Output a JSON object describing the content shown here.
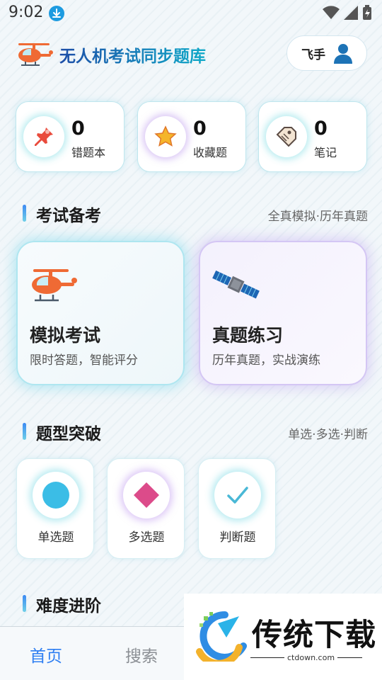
{
  "status_bar": {
    "time": "9:02"
  },
  "header": {
    "title": "无人机考试同步题库",
    "user_name": "飞手"
  },
  "stats": [
    {
      "count": "0",
      "label": "错题本",
      "icon": "pushpin-icon"
    },
    {
      "count": "0",
      "label": "收藏题",
      "icon": "star-icon"
    },
    {
      "count": "0",
      "label": "笔记",
      "icon": "tag-icon"
    }
  ],
  "exam_section": {
    "title": "考试备考",
    "subtitle": "全真模拟·历年真题",
    "cards": [
      {
        "title": "模拟考试",
        "desc": "限时答题，智能评分",
        "icon": "helicopter-icon"
      },
      {
        "title": "真题练习",
        "desc": "历年真题，实战演练",
        "icon": "satellite-icon"
      }
    ]
  },
  "qtype_section": {
    "title": "题型突破",
    "subtitle": "单选·多选·判断",
    "items": [
      {
        "label": "单选题",
        "icon": "circle-icon"
      },
      {
        "label": "多选题",
        "icon": "diamond-icon"
      },
      {
        "label": "判断题",
        "icon": "checkmark-icon"
      }
    ]
  },
  "difficulty_section": {
    "title": "难度进阶"
  },
  "bottom_nav": {
    "home": "首页",
    "search": "搜索"
  },
  "watermark": {
    "title": "传统下载",
    "url": "ctdown.com"
  },
  "colors": {
    "accent": "#2d7ef2",
    "brand_teal": "#0fa9c8",
    "orange": "#ef6a34"
  }
}
